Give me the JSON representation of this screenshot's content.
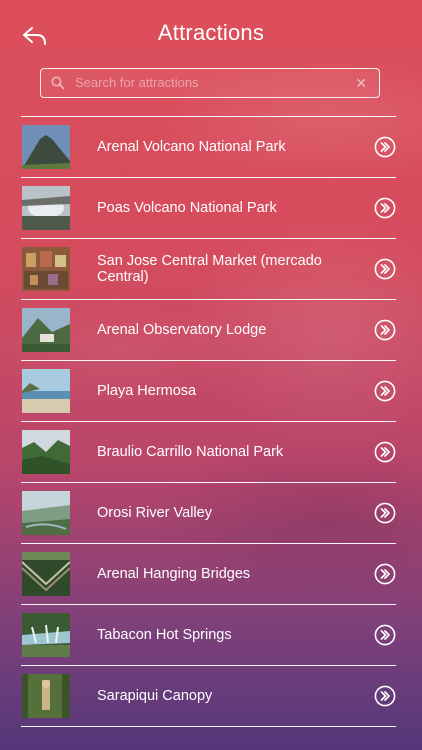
{
  "header": {
    "title": "Attractions",
    "back_icon": "back-arrow-icon"
  },
  "search": {
    "placeholder": "Search for attractions",
    "value": "",
    "clear_label": "✕"
  },
  "attractions": [
    {
      "name": "Arenal Volcano National Park"
    },
    {
      "name": "Poas Volcano National Park"
    },
    {
      "name": "San Jose Central Market (mercado Central)"
    },
    {
      "name": "Arenal Observatory Lodge"
    },
    {
      "name": "Playa Hermosa"
    },
    {
      "name": "Braulio Carrillo National Park"
    },
    {
      "name": "Orosi River Valley"
    },
    {
      "name": "Arenal Hanging Bridges"
    },
    {
      "name": "Tabacon Hot Springs"
    },
    {
      "name": "Sarapiqui Canopy"
    }
  ],
  "colors": {
    "bg_top": "#dd4e5a",
    "bg_bottom": "#54377a",
    "text": "#ffffff"
  }
}
